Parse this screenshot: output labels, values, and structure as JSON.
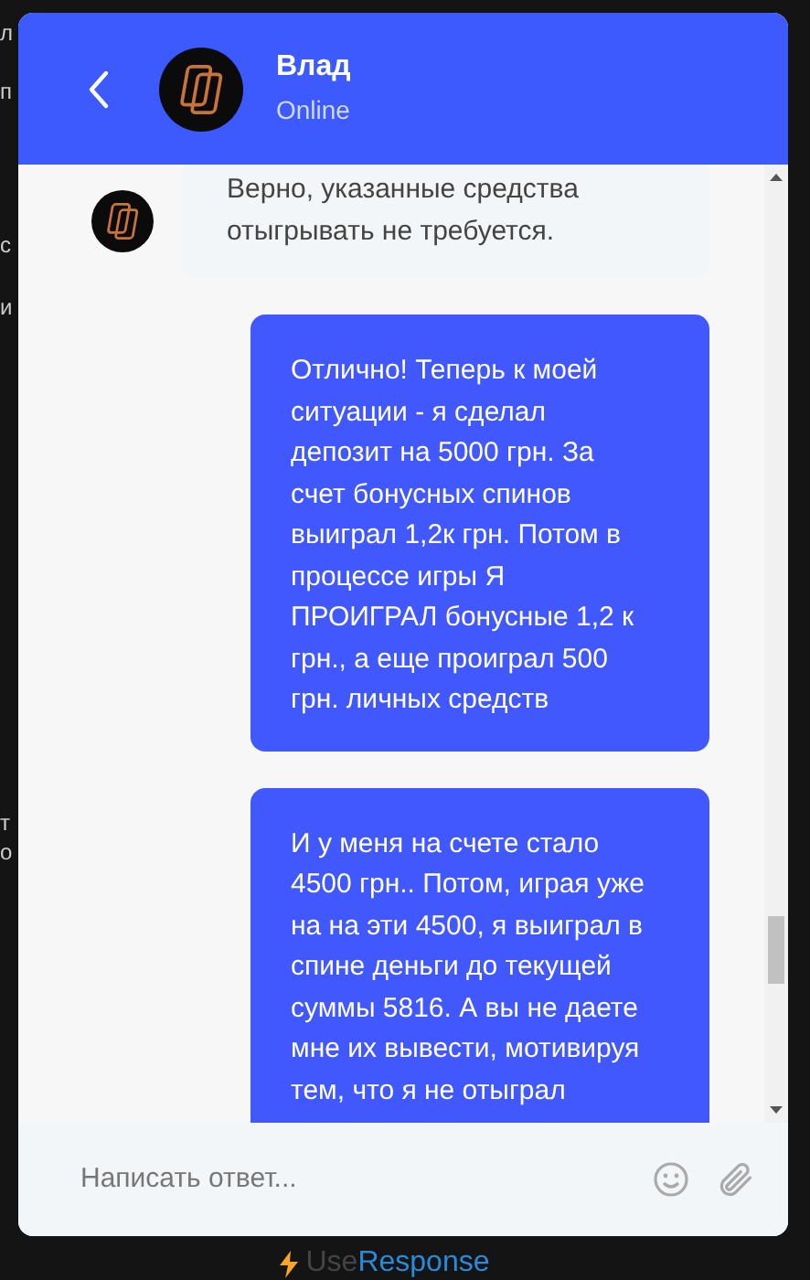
{
  "background_fragments": [
    "л",
    "п",
    "с",
    "и",
    "т",
    "о"
  ],
  "contact": {
    "name": "Влад",
    "status": "Online"
  },
  "messages": [
    {
      "kind": "incoming",
      "text": "Верно, указанные средства отыгрывать не требуется."
    },
    {
      "kind": "outgoing",
      "text": "Отлично! Теперь к моей ситуации - я сделал депозит на 5000 грн. За счет бонусных спинов выиграл 1,2к грн. Потом в процессе игры Я ПРОИГРАЛ бонусные 1,2 к грн., а еще проиграл 500 грн. личных средств"
    },
    {
      "kind": "outgoing",
      "text": "И у меня на счете стало 4500 грн.. Потом, играя уже на на эти 4500, я выиграл в спине деньги до текущей суммы 5816. А вы не даете мне их вывести, мотивируя тем, что я не отыграл"
    }
  ],
  "composer": {
    "placeholder": "Написать ответ..."
  },
  "footer": {
    "brand_prefix": "Use",
    "brand_name": "Response"
  }
}
